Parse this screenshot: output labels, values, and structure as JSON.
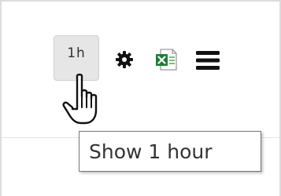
{
  "toolbar": {
    "range_button_label": "1h",
    "settings_icon": "gear-icon",
    "export_icon": "excel-export-icon",
    "menu_icon": "hamburger-menu-icon"
  },
  "tooltip": {
    "text": "Show 1 hour"
  },
  "colors": {
    "button_bg": "#e6e6e6",
    "excel_green": "#1e7e34",
    "icon_dark": "#111111"
  }
}
